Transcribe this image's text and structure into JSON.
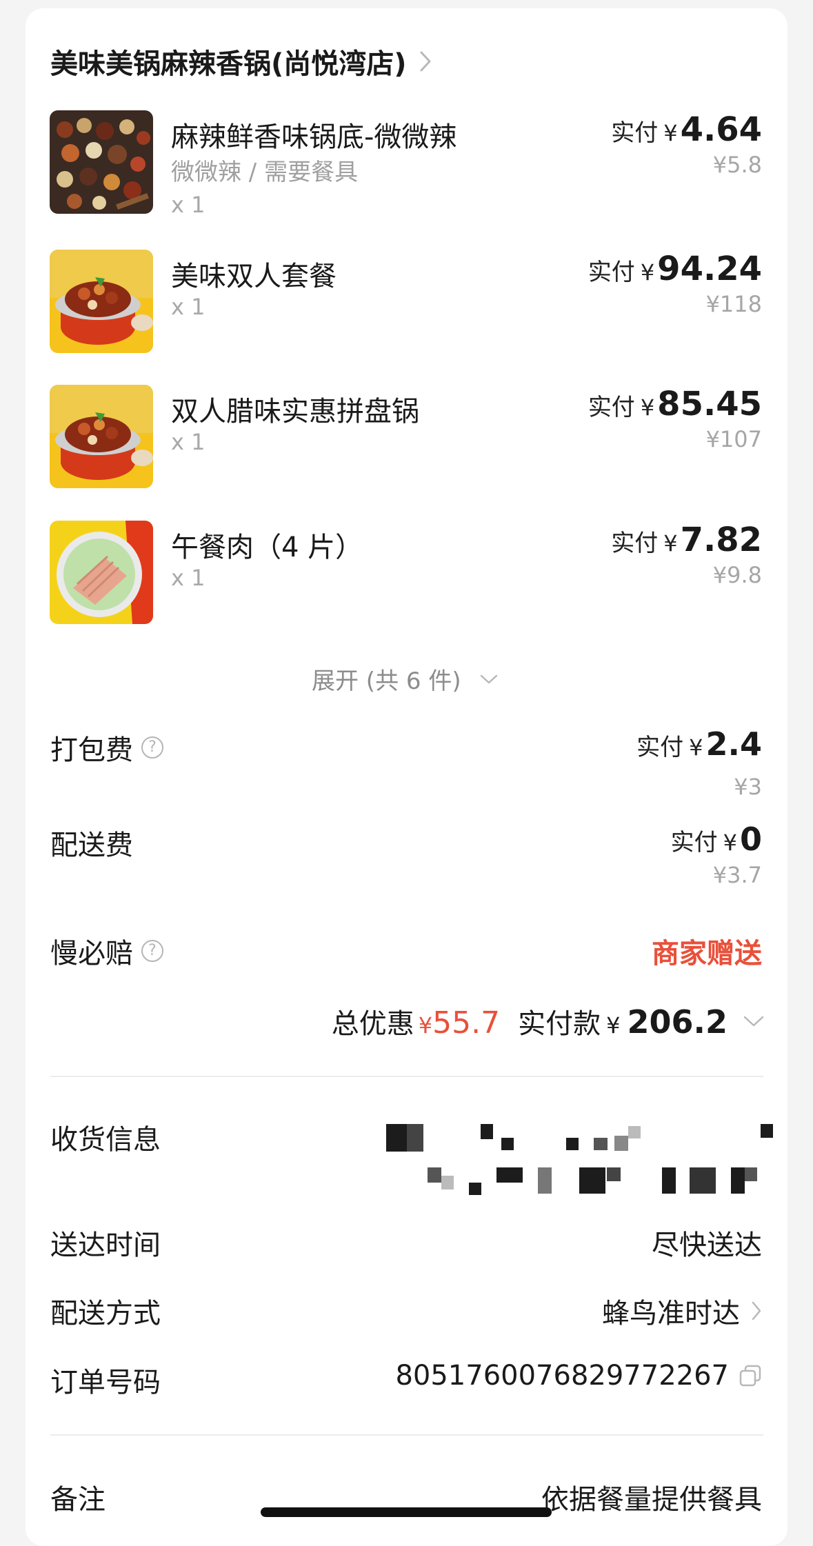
{
  "shop": {
    "name": "美味美锅麻辣香锅(尚悦湾店)"
  },
  "items": [
    {
      "name": "麻辣鲜香味锅底-微微辣",
      "spec": "微微辣 / 需要餐具",
      "qty": "x 1",
      "pay_label": "实付",
      "currency": "¥",
      "pay_amount": "4.64",
      "original": "¥5.8",
      "image": "spices-icon"
    },
    {
      "name": "美味双人套餐",
      "spec": "",
      "qty": "x 1",
      "pay_label": "实付",
      "currency": "¥",
      "pay_amount": "94.24",
      "original": "¥118",
      "image": "hotpot-icon"
    },
    {
      "name": "双人腊味实惠拼盘锅",
      "spec": "",
      "qty": "x 1",
      "pay_label": "实付",
      "currency": "¥",
      "pay_amount": "85.45",
      "original": "¥107",
      "image": "hotpot-icon"
    },
    {
      "name": "午餐肉（4 片）",
      "spec": "",
      "qty": "x 1",
      "pay_label": "实付",
      "currency": "¥",
      "pay_amount": "7.82",
      "original": "¥9.8",
      "image": "luncheon-meat-icon"
    }
  ],
  "expand": {
    "label": "展开 (共 6 件)"
  },
  "fees": {
    "packing": {
      "label": "打包费",
      "pay_label": "实付",
      "currency": "¥",
      "pay_amount": "2.4",
      "original": "¥3"
    },
    "delivery": {
      "label": "配送费",
      "pay_label": "实付",
      "currency": "¥",
      "pay_amount": "0",
      "original": "¥3.7"
    },
    "late_compensation": {
      "label": "慢必赔",
      "value": "商家赠送"
    }
  },
  "summary": {
    "discount_label": "总优惠",
    "discount_currency": "¥",
    "discount_amount": "55.7",
    "paid_label": "实付款",
    "paid_currency": "¥",
    "paid_amount": "206.2"
  },
  "info": {
    "receiver_label": "收货信息",
    "delivery_time_label": "送达时间",
    "delivery_time_value": "尽快送达",
    "delivery_method_label": "配送方式",
    "delivery_method_value": "蜂鸟准时达",
    "order_no_label": "订单号码",
    "order_no_value": "8051760076829772267",
    "remark_label": "备注",
    "remark_value": "依据餐量提供餐具"
  },
  "colors": {
    "accent_red": "#e9503a",
    "text": "#1a1a1a",
    "muted": "#a6a6a6",
    "background": "#f4f4f4"
  }
}
